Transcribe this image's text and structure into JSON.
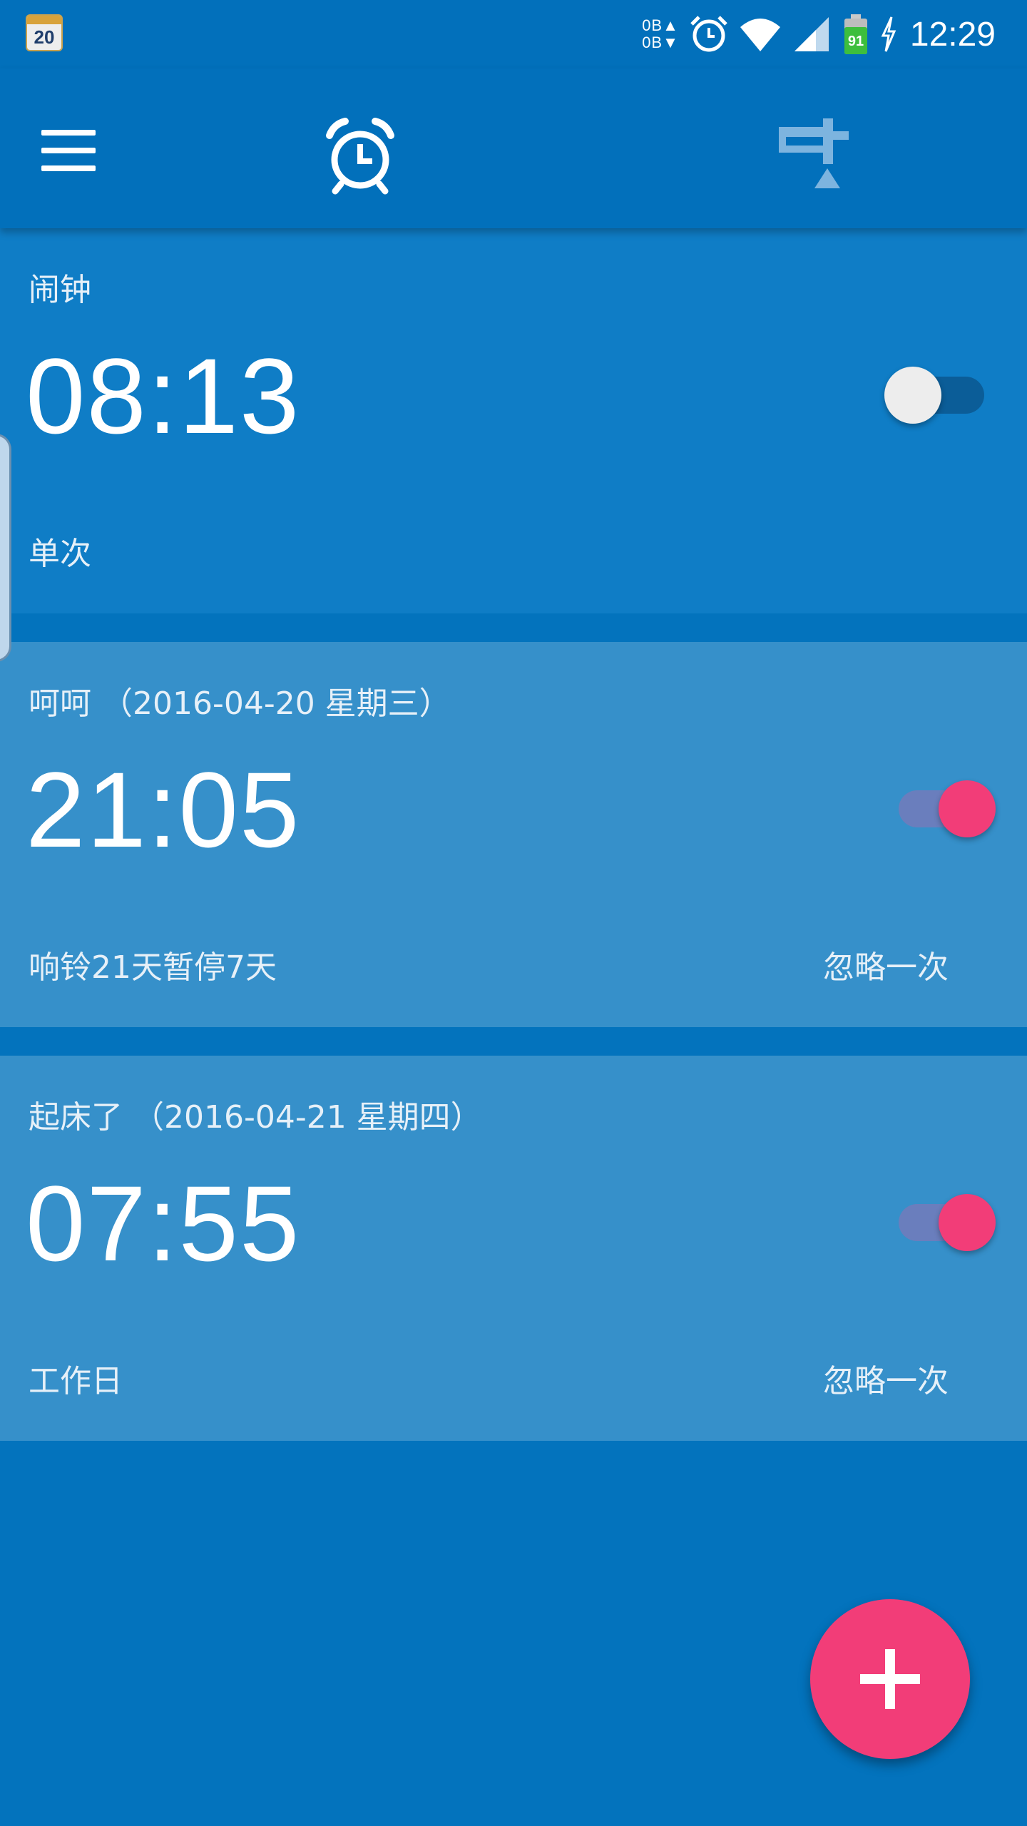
{
  "status_bar": {
    "calendar_day": "20",
    "net_up": "0B▲",
    "net_down": "0B▼",
    "battery_level": "91",
    "time": "12:29",
    "icons": [
      "calendar-icon",
      "alarm-icon",
      "wifi-icon",
      "signal-icon",
      "battery-icon",
      "charging-icon"
    ]
  },
  "app_bar": {
    "icons": [
      "menu-icon",
      "alarm-clock-icon",
      "timer-icon"
    ],
    "active_tab": "alarm"
  },
  "alarms": [
    {
      "label": "闹钟",
      "time": "08:13",
      "repeat": "单次",
      "skip": "",
      "enabled": false
    },
    {
      "label": "呵呵 （2016-04-20 星期三）",
      "time": "21:05",
      "repeat": "响铃21天暂停7天",
      "skip": "忽略一次",
      "enabled": true
    },
    {
      "label": "起床了 （2016-04-21 星期四）",
      "time": "07:55",
      "repeat": "工作日",
      "skip": "忽略一次",
      "enabled": true
    }
  ],
  "fab": {
    "icon": "plus-icon"
  },
  "colors": {
    "primary": "#0373BD",
    "app_bar": "#0270BB",
    "card_active": "#3690CA",
    "card_inactive": "#0F7DC6",
    "accent": "#F23D78"
  }
}
